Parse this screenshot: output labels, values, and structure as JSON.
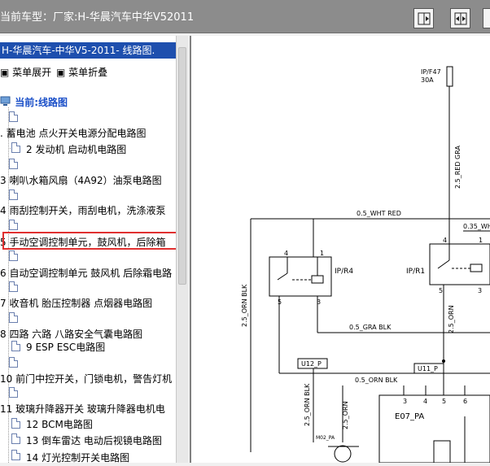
{
  "titlebar": {
    "title": "当前车型：厂家:H-华晨汽车中华V52011"
  },
  "left": {
    "header": "H-华晨汽车-中华V5-2011- 线路图.",
    "menu_expand": "菜单展开",
    "menu_collapse": "菜单折叠",
    "current": "当前:线路图",
    "items": [
      {
        "num": ".",
        "label": "蓄电池 点火开关电源分配电路图"
      },
      {
        "num": "2",
        "label": "发动机 启动机电路图"
      },
      {
        "num": "3",
        "label": "喇叭水箱风扇（4A92）油泵电路图"
      },
      {
        "num": "4",
        "label": "雨刮控制开关，雨刮电机，洗涤液泵"
      },
      {
        "num": "5",
        "label": "手动空调控制单元，鼓风机，后除箱"
      },
      {
        "num": "6",
        "label": "自动空调控制单元 鼓风机 后除霜电路"
      },
      {
        "num": "7",
        "label": "收音机 胎压控制器 点烟器电路图"
      },
      {
        "num": "8",
        "label": "四路 六路 八路安全气囊电路图"
      },
      {
        "num": "9",
        "label": "ESP ESC电路图"
      },
      {
        "num": "10",
        "label": "前门中控开关，门锁电机，警告灯机"
      },
      {
        "num": "11",
        "label": "玻璃升降器开关 玻璃升降器电机电"
      },
      {
        "num": "12",
        "label": "BCM电路图"
      },
      {
        "num": "13",
        "label": "倒车雷达 电动后视镜电路图"
      },
      {
        "num": "14",
        "label": "灯光控制开关电路图"
      }
    ]
  },
  "diagram": {
    "fuse_label": "IP/F47",
    "fuse_rating": "30A",
    "wire_red_gra": "2.5_RED GRA",
    "wire_wht_red": "0.5_WHT RED",
    "wire_wht": "0.35_WH",
    "relay_left": "IP/R4",
    "relay_right": "IP/R1",
    "wire_orn_blk_left": "2.5_ORN BLK",
    "wire_gra_blk": "0.5_GRA BLK",
    "wire_orn": "2.5_ORN",
    "conn_u12": "U12_P",
    "conn_u11": "U11_P",
    "wire_orn_blk": "0.5_ORN BLK",
    "wire_orn_blk_2": "2.5_ORN BLK",
    "wire_orn_2": "2.5_ORN",
    "connector_name": "E07_PA",
    "m_label": "M02_PA",
    "pins_4": "4",
    "pins_1": "1",
    "pins_5": "5",
    "pins_3": "3",
    "pins_2": "2",
    "pins_6": "6"
  }
}
